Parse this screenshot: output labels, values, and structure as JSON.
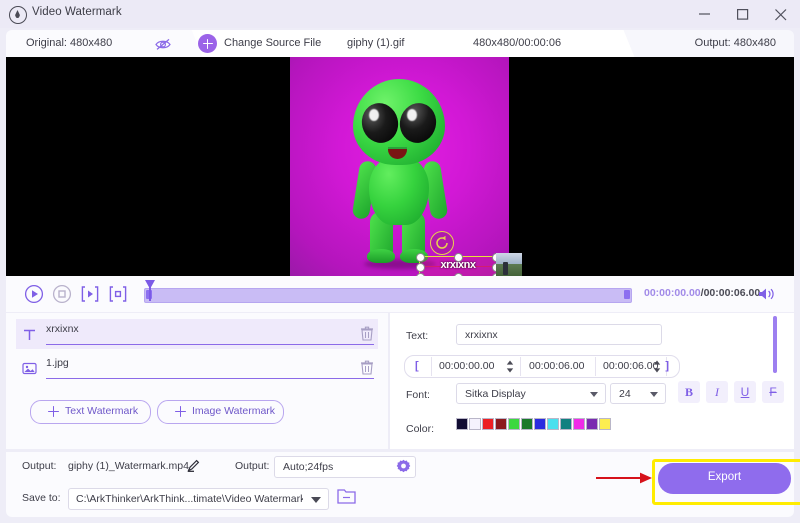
{
  "window": {
    "title": "Video Watermark",
    "minimize_label": "Minimize",
    "maximize_label": "Maximize",
    "close_label": "Close"
  },
  "source_bar": {
    "original_label": "Original: 480x480",
    "hide_icon": "eye-slash-icon",
    "change_source_label": "Change Source File",
    "source_file": "giphy (1).gif",
    "source_meta": "480x480/00:00:06",
    "output_label": "Output: 480x480"
  },
  "preview": {
    "watermark_text": "xrxixnx",
    "rotate_icon": "rotate-icon",
    "image_watermark_name": "1.jpg"
  },
  "player": {
    "play_icon": "play-icon",
    "stop_icon": "stop-icon",
    "mark_in_icon": "mark-in-icon",
    "mark_out_icon": "mark-out-icon",
    "current_time": "00:00:00.00",
    "separator": "/",
    "total_time": "00:00:06.00",
    "volume_icon": "volume-icon"
  },
  "watermark_list": {
    "items": [
      {
        "name": "xrxixnx",
        "type_icon": "text-icon",
        "delete_icon": "trash-icon",
        "selected": true
      },
      {
        "name": "1.jpg",
        "type_icon": "image-icon",
        "delete_icon": "trash-icon",
        "selected": false
      }
    ],
    "add_text_label": "Text Watermark",
    "add_image_label": "Image Watermark"
  },
  "properties": {
    "text_label": "Text:",
    "text_value": "xrxixnx",
    "bracket_in": "[",
    "bracket_out": "]",
    "start_time": "00:00:00.00",
    "end_time": "00:00:06.00",
    "duration_time": "00:00:06.00",
    "font_label": "Font:",
    "font_family": "Sitka Display",
    "font_size": "24",
    "bold_label": "B",
    "italic_label": "I",
    "underline_label": "U",
    "strike_label": "F",
    "color_label": "Color:",
    "colors": [
      "#120d33",
      "#f5f2fd",
      "#ed2024",
      "#8c1a1e",
      "#3cd83f",
      "#1a7a2a",
      "#2b2be0",
      "#4ae0ee",
      "#128080",
      "#ef2ce8",
      "#7a2ab0",
      "#fced50"
    ],
    "more_colors": "···"
  },
  "bottom_bar": {
    "output_label": "Output:",
    "output_filename": "giphy (1)_Watermark.mp4",
    "edit_icon": "pencil-icon",
    "format_label": "Output:",
    "format_value": "Auto;24fps",
    "settings_icon": "gear-icon",
    "save_to_label": "Save to:",
    "save_to_path": "C:\\ArkThinker\\ArkThink...timate\\Video Watermark",
    "folder_icon": "folder-icon",
    "export_label": "Export"
  }
}
